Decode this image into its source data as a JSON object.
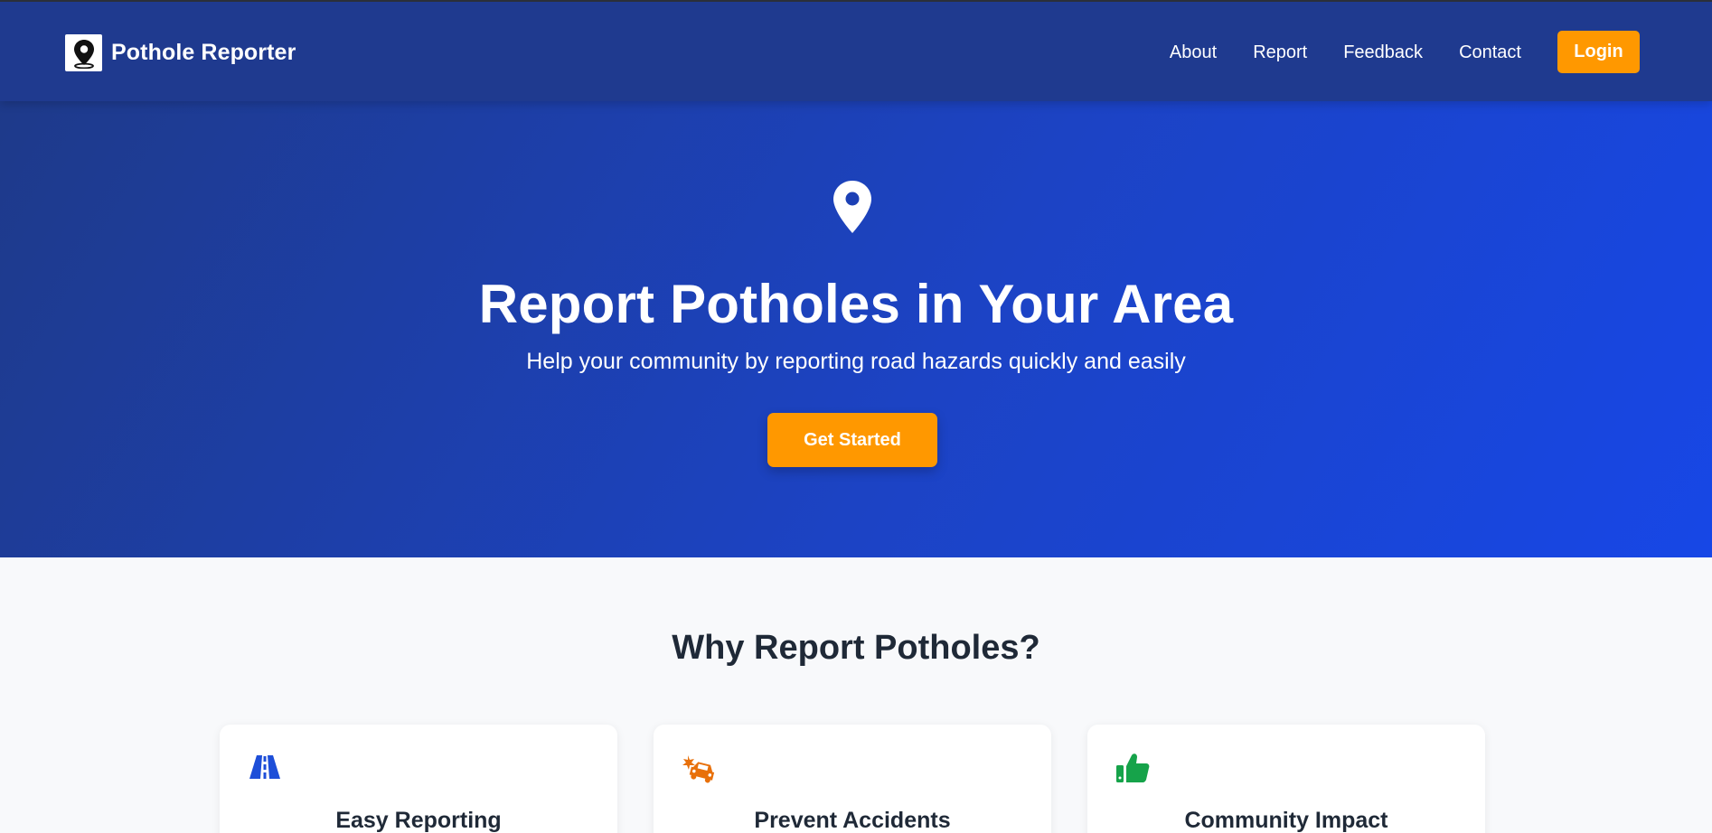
{
  "brand": {
    "name": "Pothole Reporter",
    "logo_icon": "map-pin-icon"
  },
  "nav": {
    "links": [
      {
        "label": "About"
      },
      {
        "label": "Report"
      },
      {
        "label": "Feedback"
      },
      {
        "label": "Contact"
      }
    ],
    "login_label": "Login"
  },
  "hero": {
    "icon": "map-marker-icon",
    "title": "Report Potholes in Your Area",
    "subtitle": "Help your community by reporting road hazards quickly and easily",
    "cta_label": "Get Started"
  },
  "features": {
    "title": "Why Report Potholes?",
    "cards": [
      {
        "title": "Easy Reporting",
        "icon": "road-icon",
        "icon_color": "#1d4ed8"
      },
      {
        "title": "Prevent Accidents",
        "icon": "car-crash-icon",
        "icon_color": "#e8700a"
      },
      {
        "title": "Community Impact",
        "icon": "thumbs-up-icon",
        "icon_color": "#16a34a"
      }
    ]
  },
  "colors": {
    "nav_bg": "#1f3a8f",
    "hero_gradient_start": "#1e3a8a",
    "hero_gradient_end": "#1747e6",
    "accent": "#ff9800",
    "page_bg": "#f8f9fb",
    "heading_text": "#1f2937"
  }
}
